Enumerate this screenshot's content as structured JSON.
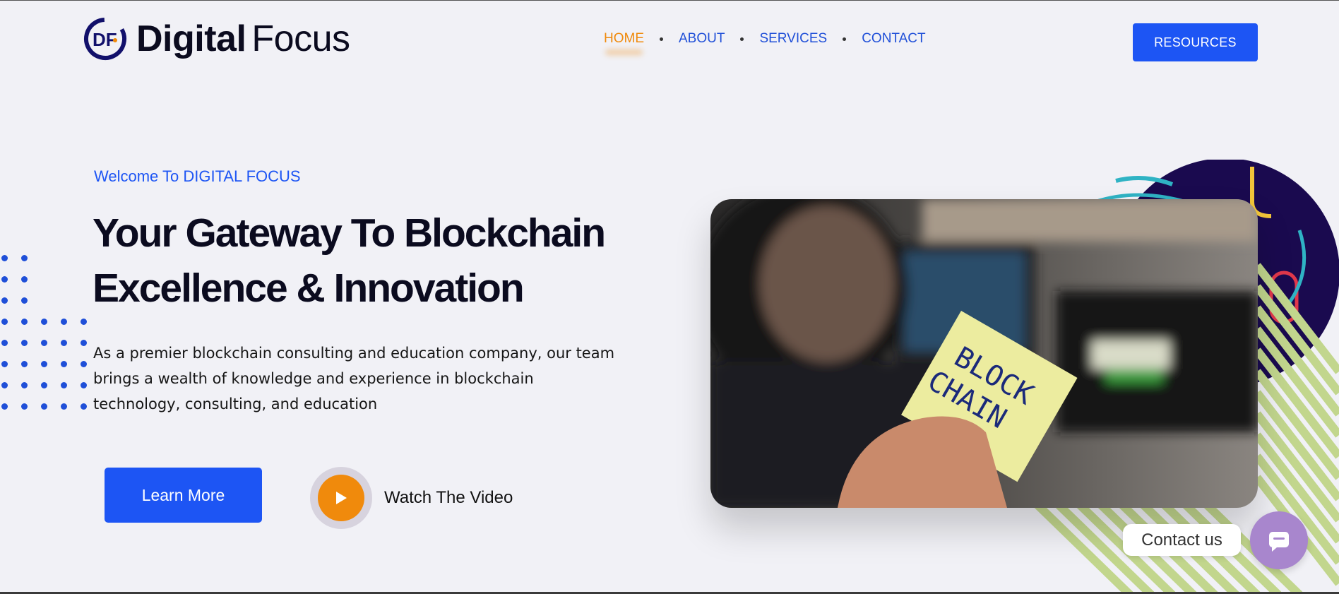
{
  "brand": {
    "name_bold": "Digital",
    "name_light": "Focus",
    "logo_initials": "DF"
  },
  "nav": {
    "items": [
      {
        "label": "HOME",
        "active": true
      },
      {
        "label": "ABOUT",
        "active": false
      },
      {
        "label": "SERVICES",
        "active": false
      },
      {
        "label": "CONTACT",
        "active": false
      }
    ],
    "resources_label": "RESOURCES"
  },
  "hero": {
    "welcome": "Welcome To DIGITAL FOCUS",
    "headline_line1": "Your Gateway To Blockchain",
    "headline_line2": "Excellence & Innovation",
    "description": "As a premier blockchain consulting and education company, our team brings a wealth of knowledge and experience in blockchain technology, consulting, and education",
    "learn_more_label": "Learn More",
    "watch_video_label": "Watch The Video"
  },
  "photo": {
    "note_line1": "BLOCK",
    "note_line2": "CHAIN"
  },
  "contact": {
    "label": "Contact us"
  },
  "colors": {
    "accent_blue": "#1d55f4",
    "accent_orange": "#f08a0c",
    "navy": "#12106b",
    "chat_purple": "#a886cd"
  }
}
